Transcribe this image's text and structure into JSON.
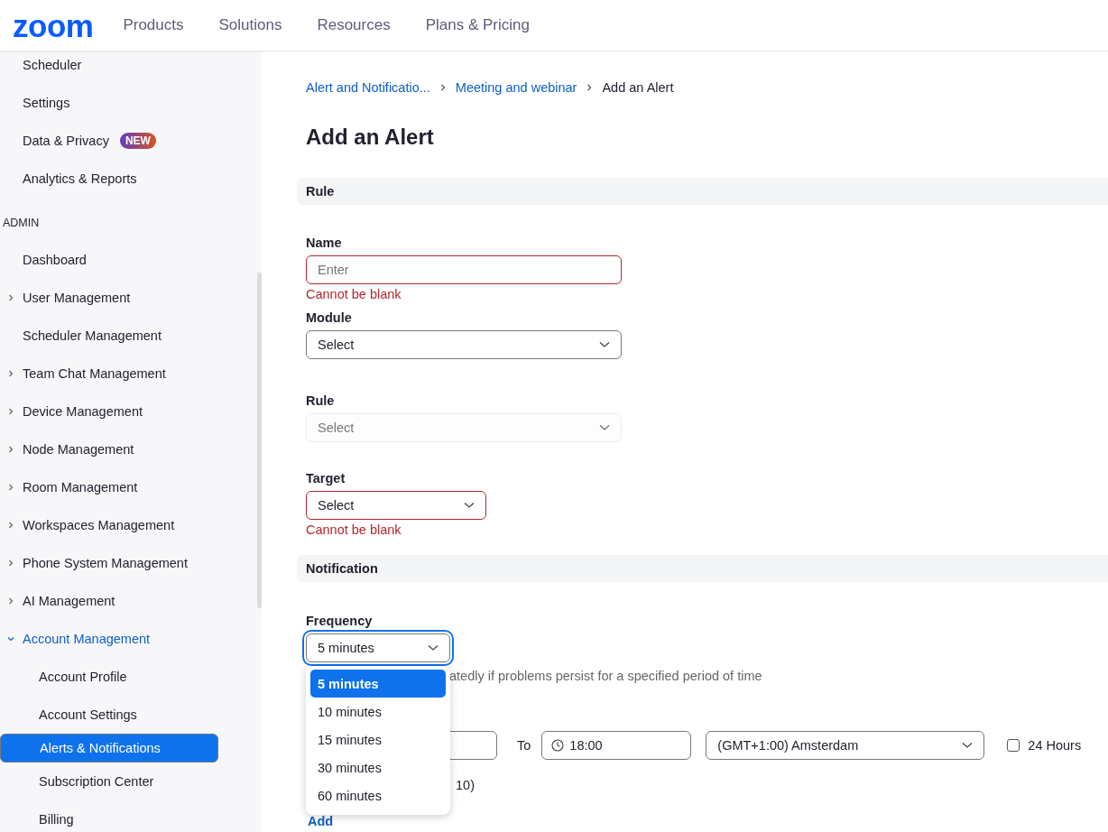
{
  "header": {
    "logo": "zoom",
    "nav": [
      "Products",
      "Solutions",
      "Resources",
      "Plans & Pricing"
    ]
  },
  "sidebar": {
    "items": [
      {
        "label": "Scheduler",
        "kind": "item",
        "selected": false
      },
      {
        "label": "Settings",
        "kind": "item",
        "selected": false
      },
      {
        "label": "Data & Privacy",
        "kind": "item",
        "selected": false,
        "badge": "NEW"
      },
      {
        "label": "Analytics & Reports",
        "kind": "item",
        "selected": false
      },
      {
        "label": "ADMIN",
        "kind": "heading"
      },
      {
        "label": "Dashboard",
        "kind": "item",
        "selected": false
      },
      {
        "label": "User Management",
        "kind": "group",
        "expanded": false,
        "selected": false
      },
      {
        "label": "Scheduler Management",
        "kind": "item",
        "selected": false
      },
      {
        "label": "Team Chat Management",
        "kind": "group",
        "expanded": false,
        "selected": false
      },
      {
        "label": "Device Management",
        "kind": "group",
        "expanded": false,
        "selected": false
      },
      {
        "label": "Node Management",
        "kind": "group",
        "expanded": false,
        "selected": false
      },
      {
        "label": "Room Management",
        "kind": "group",
        "expanded": false,
        "selected": false
      },
      {
        "label": "Workspaces Management",
        "kind": "group",
        "expanded": false,
        "selected": false
      },
      {
        "label": "Phone System Management",
        "kind": "group",
        "expanded": false,
        "selected": false
      },
      {
        "label": "AI Management",
        "kind": "group",
        "expanded": false,
        "selected": false
      },
      {
        "label": "Account Management",
        "kind": "group",
        "expanded": true,
        "selected": false
      },
      {
        "label": "Account Profile",
        "kind": "subitem",
        "selected": false
      },
      {
        "label": "Account Settings",
        "kind": "subitem",
        "selected": false
      },
      {
        "label": "Alerts & Notifications",
        "kind": "subitem",
        "selected": true
      },
      {
        "label": "Subscription Center",
        "kind": "subitem",
        "selected": false
      },
      {
        "label": "Billing",
        "kind": "subitem",
        "selected": false
      }
    ]
  },
  "breadcrumb": [
    {
      "label": "Alert and Notificatio...",
      "link": true
    },
    {
      "label": "Meeting and webinar",
      "link": true
    },
    {
      "label": "Add an Alert",
      "link": false
    }
  ],
  "title": "Add an Alert",
  "rule_section": {
    "heading": "Rule",
    "fields": [
      {
        "label": "Name",
        "kind": "input",
        "placeholder": "Enter",
        "error": "Cannot be blank",
        "disabled": false,
        "wide": true
      },
      {
        "label": "Module",
        "kind": "select",
        "value": "Select",
        "disabled": false,
        "wide": true
      },
      {
        "label": "Rule",
        "kind": "select",
        "value": "Select",
        "disabled": true,
        "wide": true
      },
      {
        "label": "Target",
        "kind": "select",
        "value": "Select",
        "error": "Cannot be blank",
        "disabled": false,
        "wide": false
      }
    ]
  },
  "notification_section": {
    "heading": "Notification",
    "frequency": {
      "label": "Frequency",
      "value": "5 minutes",
      "expanded": true,
      "options": [
        {
          "label": "5 minutes",
          "selected": true
        },
        {
          "label": "10 minutes",
          "selected": false
        },
        {
          "label": "15 minutes",
          "selected": false
        },
        {
          "label": "30 minutes",
          "selected": false
        },
        {
          "label": "60 minutes",
          "selected": false
        }
      ]
    },
    "description": "atedly if problems persist for a specified period of time",
    "time_row": {
      "to_label": "To",
      "to_time": "18:00",
      "timezone": "(GMT+1:00) Amsterdam",
      "all_day": {
        "label": "24 Hours",
        "checked": false
      }
    },
    "limit_text": "10)",
    "add_link": "Add"
  }
}
